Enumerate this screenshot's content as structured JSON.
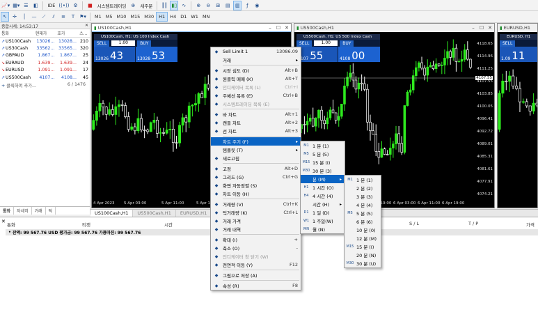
{
  "toolbar1": {
    "ide": "IDE",
    "algo_trading": "시스템트레이딩",
    "new_order": "새주문"
  },
  "toolbar2": {
    "timeframes": [
      "M1",
      "M5",
      "M10",
      "M15",
      "M30",
      "H1",
      "H4",
      "D1",
      "W1",
      "MN"
    ],
    "active_timeframe": "H1"
  },
  "market_watch": {
    "title": "종합시세: 14:53:17",
    "headers": [
      "통화",
      "현재가",
      "호가",
      "스..."
    ],
    "rows": [
      {
        "symbol": "US100Cash",
        "bid": "13026...",
        "ask": "13028...",
        "spread": "210",
        "dir": "up"
      },
      {
        "symbol": "US30Cash",
        "bid": "33562...",
        "ask": "33565...",
        "spread": "320",
        "dir": "up"
      },
      {
        "symbol": "GBPAUD",
        "bid": "1.867...",
        "ask": "1.867...",
        "spread": "25",
        "dir": "up"
      },
      {
        "symbol": "EURAUD",
        "bid": "1.639...",
        "ask": "1.639...",
        "spread": "24",
        "dir": "dn"
      },
      {
        "symbol": "EURUSD",
        "bid": "1.091...",
        "ask": "1.091...",
        "spread": "17",
        "dir": "dn"
      },
      {
        "symbol": "US500Cash",
        "bid": "4107...",
        "ask": "4108...",
        "spread": "45",
        "dir": "up"
      }
    ],
    "add_symbol": "클릭하여 추가...",
    "count": "6 / 1476",
    "tabs": [
      "통화",
      "자세히",
      "거래",
      "틱"
    ]
  },
  "charts": [
    {
      "title": "US100Cash,H1",
      "panel_title": "US100Cash, H1:  US 100 Index Cash",
      "sell_label": "SELL",
      "buy_label": "BUY",
      "lot": "1.00",
      "sell_prefix": "13026",
      "sell_big": "43",
      "buy_prefix": "13028",
      "buy_big": "53",
      "x_labels": [
        "4 Apr 2023",
        "5 Apr 03:00",
        "5 Apr 11:00",
        "5 Apr 19:00"
      ]
    },
    {
      "title": "US500Cash,H1",
      "panel_title": "US500Cash, H1:  US 500 Index Cash",
      "sell_label": "SELL",
      "buy_label": "BUY",
      "lot": "1.00",
      "sell_prefix": "4107",
      "sell_big": "55",
      "buy_prefix": "4108",
      "buy_big": "00",
      "price_labels": [
        "4118.65",
        "4114.96",
        "4111.25",
        "4107.55",
        "4103.85",
        "4100.05",
        "4096.41",
        "4092.72",
        "4089.01",
        "4085.31",
        "4081.61",
        "4077.91",
        "4074.21"
      ],
      "current_price": "4107.55",
      "x_labels": [
        "4 Apr 2023",
        "5 Apr 03:00",
        "5 Apr 11:00",
        "5 Apr 19:00",
        "6 Apr 03:00",
        "6 Apr 11:00",
        "6 Apr 19:00"
      ]
    },
    {
      "title": "EURUSD,H1",
      "panel_title": "EURUSD, H1",
      "sell_label": "SELL",
      "sell_prefix": "1.09",
      "sell_big": "11"
    }
  ],
  "chart_tabs": [
    "US100Cash,H1",
    "US500Cash,H1",
    "EURUSD,H1"
  ],
  "terminal": {
    "headers": [
      "통화",
      "티켓",
      "시간",
      "S / L",
      "T / P",
      "가격"
    ],
    "balance": "잔액: 99 567.76 USD  평가금: 99 567.76  가용마진: 99 567.76"
  },
  "context_menu": {
    "items": [
      {
        "label": "Sell Limit 1",
        "accel": "13086.09",
        "icon": "sell-limit-icon",
        "type": "item"
      },
      {
        "label": "거래",
        "accel": "",
        "icon": "",
        "type": "submenu"
      },
      {
        "type": "sep"
      },
      {
        "label": "시장 심도 (D)",
        "accel": "Alt+B",
        "icon": "depth-icon",
        "type": "item"
      },
      {
        "label": "원클릭 매매 (K)",
        "accel": "Alt+T",
        "icon": "oneclick-icon",
        "type": "item"
      },
      {
        "label": "인디케이터 목록 (L)",
        "accel": "Ctrl+I",
        "icon": "indicators-icon",
        "type": "disabled"
      },
      {
        "label": "주체선 목록 (E)",
        "accel": "Ctrl+B",
        "icon": "objects-icon",
        "type": "item"
      },
      {
        "label": "시스템트레이딩 목록 (E)",
        "accel": "",
        "icon": "experts-icon",
        "type": "disabled"
      },
      {
        "type": "sep"
      },
      {
        "label": "바 차트",
        "accel": "Alt+1",
        "icon": "bar-chart-icon",
        "type": "item"
      },
      {
        "label": "캔들 차트",
        "accel": "Alt+2",
        "icon": "candle-chart-icon",
        "type": "item"
      },
      {
        "label": "선 차트",
        "accel": "Alt+3",
        "icon": "line-chart-icon",
        "type": "item"
      },
      {
        "type": "sep"
      },
      {
        "label": "차트 주기 (F)",
        "accel": "",
        "icon": "",
        "type": "highlight"
      },
      {
        "label": "템플릿 (T)",
        "accel": "",
        "icon": "",
        "type": "submenu"
      },
      {
        "label": "새로고침",
        "accel": "",
        "icon": "refresh-icon",
        "type": "item"
      },
      {
        "type": "sep"
      },
      {
        "label": "고정",
        "accel": "Alt+D",
        "icon": "pin-icon",
        "type": "item"
      },
      {
        "label": "그리드 (G)",
        "accel": "Ctrl+G",
        "icon": "grid-icon",
        "type": "item"
      },
      {
        "label": "화면 자동정렬 (S)",
        "accel": "",
        "icon": "autoscroll-icon",
        "type": "item"
      },
      {
        "label": "차트 이동 (H)",
        "accel": "",
        "icon": "chart-shift-icon",
        "type": "item"
      },
      {
        "type": "sep"
      },
      {
        "label": "거래량 (V)",
        "accel": "Ctrl+K",
        "icon": "volume-icon",
        "type": "item"
      },
      {
        "label": "틱거래량 (K)",
        "accel": "Ctrl+L",
        "icon": "tick-volume-icon",
        "type": "item"
      },
      {
        "label": "거래 가격",
        "accel": "",
        "icon": "trade-price-icon",
        "type": "item"
      },
      {
        "label": "거래 내역",
        "accel": "",
        "icon": "trade-history-icon",
        "type": "item"
      },
      {
        "type": "sep"
      },
      {
        "label": "확대 (I)",
        "accel": "+",
        "icon": "zoom-in-icon",
        "type": "item"
      },
      {
        "label": "축소 (O)",
        "accel": "-",
        "icon": "zoom-out-icon",
        "type": "item"
      },
      {
        "label": "인디케이터 창 닫기 (W)",
        "accel": "",
        "icon": "close-window-icon",
        "type": "disabled"
      },
      {
        "label": "전면적 이동 (Y)",
        "accel": "F12",
        "icon": "step-icon",
        "type": "item"
      },
      {
        "type": "sep"
      },
      {
        "label": "그림으로 저장 (A)",
        "accel": "",
        "icon": "save-image-icon",
        "type": "item"
      },
      {
        "type": "sep"
      },
      {
        "label": "속성 (R)",
        "accel": "F8",
        "icon": "properties-icon",
        "type": "item"
      }
    ]
  },
  "period_menu": {
    "items": [
      {
        "tag": "M1",
        "label": "1 분 (1)",
        "type": "item"
      },
      {
        "tag": "M5",
        "label": "5 분 (5)",
        "type": "item"
      },
      {
        "tag": "M15",
        "label": "15 분 (I)",
        "type": "item"
      },
      {
        "tag": "M30",
        "label": "30 분 (3)",
        "type": "item"
      },
      {
        "tag": "",
        "label": "분 (M)",
        "type": "highlight"
      },
      {
        "tag": "H1",
        "label": "1 시간 (O)",
        "type": "item"
      },
      {
        "tag": "H4",
        "label": "4 시간 (4)",
        "type": "item"
      },
      {
        "tag": "",
        "label": "시간 (H)",
        "type": "submenu"
      },
      {
        "tag": "D1",
        "label": "1 일 (D)",
        "type": "item"
      },
      {
        "tag": "W1",
        "label": "1 주일(W)",
        "type": "item"
      },
      {
        "tag": "MN",
        "label": "월 (N)",
        "type": "item"
      }
    ]
  },
  "minutes_menu": {
    "items": [
      {
        "tag": "M1",
        "label": "1 분 (1)"
      },
      {
        "tag": "",
        "label": "2 분 (2)"
      },
      {
        "tag": "",
        "label": "3 분 (3)"
      },
      {
        "tag": "",
        "label": "4 분 (4)"
      },
      {
        "tag": "M5",
        "label": "5 분 (5)"
      },
      {
        "tag": "",
        "label": "6 분 (6)"
      },
      {
        "tag": "",
        "label": "10 분 (0)"
      },
      {
        "tag": "",
        "label": "12 분 (M)"
      },
      {
        "tag": "M15",
        "label": "15 분 (I)"
      },
      {
        "tag": "",
        "label": "20 분 (N)"
      },
      {
        "tag": "M30",
        "label": "30 분 (U)"
      }
    ]
  },
  "colors": {
    "bull": "#2eea1e",
    "bear": "#ffffff",
    "accent": "#0a64c4"
  }
}
